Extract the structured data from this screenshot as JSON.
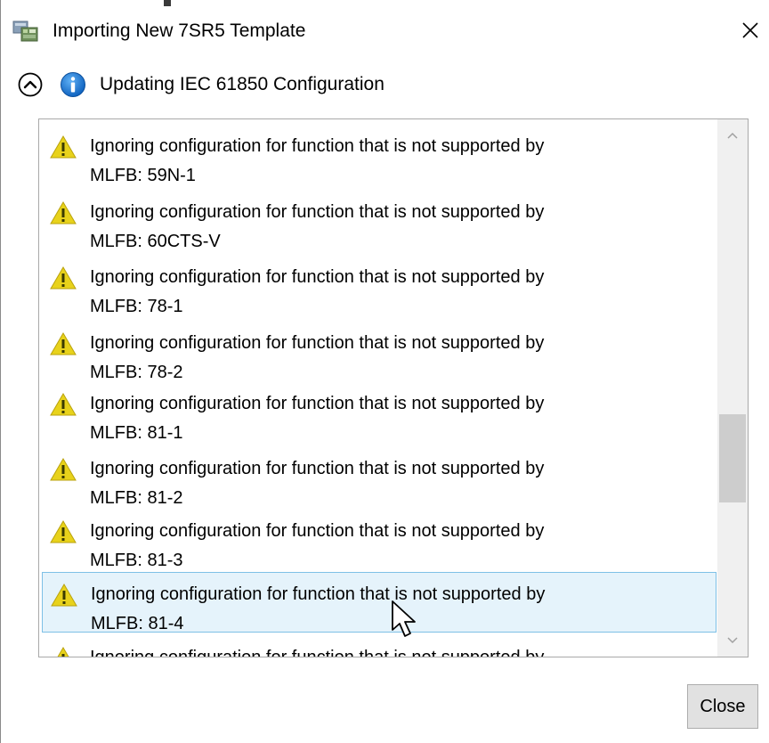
{
  "window": {
    "title": "Importing New 7SR5 Template",
    "title_icon": "template-import-icon",
    "close_icon": "close-icon"
  },
  "section": {
    "title": "Updating IEC 61850 Configuration",
    "collapse_icon": "chevron-up-icon",
    "status_icon": "info-icon"
  },
  "messages": [
    {
      "icon": "warning-icon",
      "line1": "Ignoring configuration for function that is not supported by",
      "line2": "MLFB: 59N-1",
      "selected": false
    },
    {
      "icon": "warning-icon",
      "line1": "Ignoring configuration for function that is not supported by",
      "line2": "MLFB: 60CTS-V",
      "selected": false
    },
    {
      "icon": "warning-icon",
      "line1": "Ignoring configuration for function that is not supported by",
      "line2": "MLFB: 78-1",
      "selected": false
    },
    {
      "icon": "warning-icon",
      "line1": "Ignoring configuration for function that is not supported by",
      "line2": "MLFB: 78-2",
      "selected": false
    },
    {
      "icon": "warning-icon",
      "line1": "Ignoring configuration for function that is not supported by",
      "line2": "MLFB: 81-1",
      "selected": false
    },
    {
      "icon": "warning-icon",
      "line1": "Ignoring configuration for function that is not supported by",
      "line2": "MLFB: 81-2",
      "selected": false
    },
    {
      "icon": "warning-icon",
      "line1": "Ignoring configuration for function that is not supported by",
      "line2": "MLFB: 81-3",
      "selected": false
    },
    {
      "icon": "warning-icon",
      "line1": "Ignoring configuration for function that is not supported by",
      "line2": "MLFB: 81-4",
      "selected": true
    },
    {
      "icon": "warning-icon",
      "line1": "Ignoring configuration for function that is not supported by",
      "line2": "",
      "selected": false
    }
  ],
  "buttons": {
    "close_label": "Close"
  },
  "colors": {
    "warning": "#e8d21b",
    "info": "#1a78d4",
    "selection_bg": "#e5f3fb",
    "selection_border": "#7ec0e6"
  }
}
